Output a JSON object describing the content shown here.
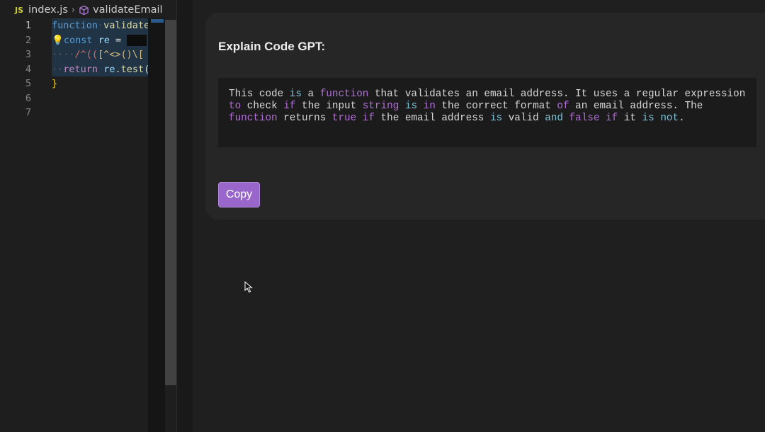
{
  "editor": {
    "breadcrumb": {
      "lang_badge": "JS",
      "file": "index.js",
      "separator": "›",
      "symbol": "validateEmail",
      "symbol_icon": "cube-icon"
    },
    "line_numbers": [
      "1",
      "2",
      "3",
      "4",
      "5",
      "6",
      "7"
    ],
    "active_line": 1,
    "code_lines": [
      {
        "tokens": [
          {
            "t": "kw",
            "v": "function"
          },
          {
            "t": "ws",
            "v": "·"
          },
          {
            "t": "fn",
            "v": "validate"
          }
        ]
      },
      {
        "tokens": [
          {
            "t": "bulb",
            "v": "💡"
          },
          {
            "t": "kw",
            "v": "const"
          },
          {
            "t": "pl",
            "v": " "
          },
          {
            "t": "var",
            "v": "re"
          },
          {
            "t": "pl",
            "v": " = "
          }
        ],
        "redacted": true
      },
      {
        "tokens": [
          {
            "t": "ws",
            "v": "····"
          },
          {
            "t": "rx",
            "v": "/^(("
          },
          {
            "t": "rx2",
            "v": "[^<>()\\["
          }
        ]
      },
      {
        "tokens": [
          {
            "t": "ws",
            "v": "··"
          },
          {
            "t": "ret",
            "v": "return"
          },
          {
            "t": "pl",
            "v": " "
          },
          {
            "t": "var",
            "v": "re"
          },
          {
            "t": "pl",
            "v": "."
          },
          {
            "t": "fn",
            "v": "test"
          },
          {
            "t": "pl",
            "v": "("
          }
        ]
      },
      {
        "tokens": [
          {
            "t": "brace",
            "v": "}"
          }
        ]
      },
      {
        "tokens": []
      },
      {
        "tokens": []
      }
    ]
  },
  "webview": {
    "title": "Explain Code GPT:",
    "explanation_tokens": [
      {
        "t": "n",
        "v": "This code "
      },
      {
        "t": "ck",
        "v": "is"
      },
      {
        "t": "n",
        "v": " a "
      },
      {
        "t": "pk",
        "v": "function"
      },
      {
        "t": "n",
        "v": " that validates an email address. It uses a regular expression "
      },
      {
        "t": "pk",
        "v": "to"
      },
      {
        "t": "n",
        "v": " check "
      },
      {
        "t": "pk",
        "v": "if"
      },
      {
        "t": "n",
        "v": " the input "
      },
      {
        "t": "pk",
        "v": "string"
      },
      {
        "t": "n",
        "v": " "
      },
      {
        "t": "ck",
        "v": "is"
      },
      {
        "t": "n",
        "v": " "
      },
      {
        "t": "pk",
        "v": "in"
      },
      {
        "t": "n",
        "v": " the correct format "
      },
      {
        "t": "pk",
        "v": "of"
      },
      {
        "t": "n",
        "v": " an email address. The "
      },
      {
        "t": "pk",
        "v": "function"
      },
      {
        "t": "n",
        "v": " returns "
      },
      {
        "t": "pk",
        "v": "true"
      },
      {
        "t": "n",
        "v": " "
      },
      {
        "t": "pk",
        "v": "if"
      },
      {
        "t": "n",
        "v": " the email address "
      },
      {
        "t": "ck",
        "v": "is"
      },
      {
        "t": "n",
        "v": " valid "
      },
      {
        "t": "ck",
        "v": "and"
      },
      {
        "t": "n",
        "v": " "
      },
      {
        "t": "pk",
        "v": "false"
      },
      {
        "t": "n",
        "v": " "
      },
      {
        "t": "pk",
        "v": "if"
      },
      {
        "t": "n",
        "v": " it "
      },
      {
        "t": "ck",
        "v": "is"
      },
      {
        "t": "n",
        "v": " "
      },
      {
        "t": "ck",
        "v": "not"
      },
      {
        "t": "n",
        "v": "."
      }
    ],
    "copy_label": "Copy",
    "accent_color": "#9966cc"
  }
}
